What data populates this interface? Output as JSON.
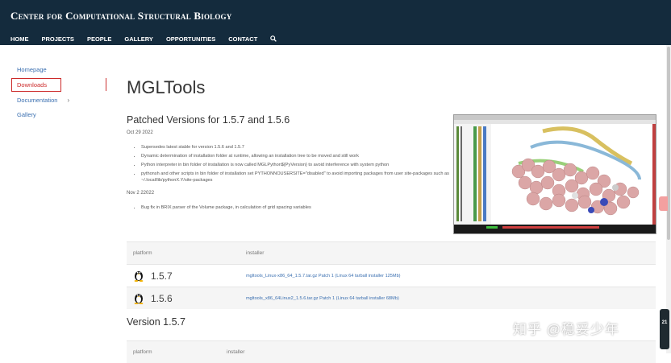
{
  "header": {
    "site_title": "Center for Computational Structural Biology",
    "nav": [
      "HOME",
      "PROJECTS",
      "PEOPLE",
      "GALLERY",
      "OPPORTUNITIES",
      "CONTACT"
    ]
  },
  "sidebar": {
    "items": [
      {
        "label": "Homepage"
      },
      {
        "label": "Downloads"
      },
      {
        "label": "Documentation"
      },
      {
        "label": "Gallery"
      }
    ]
  },
  "main": {
    "page_title": "MGLTools",
    "patched": {
      "title": "Patched Versions for 1.5.7 and 1.5.6",
      "date1": "Oct 29 2022",
      "notes1": [
        "Supersedes latest stable for version 1.5.6 and 1.5.7",
        "Dynamic determination of installation folder at runtime, allowing an installation tree to be moved and still work",
        "Python interpreter in bin folder of installation is now called MGLPython${PyVersion} to avoid interference with system python",
        "pythonsh and other scripts in bin folder of installation set PYTHONNOUSERSITE=\"disabled\" to avoid importing packages from user site-packages such as ~/.local/lib/pythonX.Y/site-packages"
      ],
      "date2": "Nov 2 22022",
      "notes2": [
        "Bug fix in BRIX parser of the Volume package, in calculation of grid spacing variables"
      ]
    },
    "table1": {
      "headers": [
        "platform",
        "installer"
      ],
      "rows": [
        {
          "version": "1.5.7",
          "link": "mgltools_Linux-x86_64_1.5.7.tar.gz Patch 1 (Linux 64 tarball installer 125Mb)"
        },
        {
          "version": "1.5.6",
          "link": "mgltools_x86_64Linux2_1.5.6.tar.gz Patch 1 (Linux 64 tarball installer 68Mb)"
        }
      ]
    },
    "version_title": "Version 1.5.7",
    "table2": {
      "headers": [
        "platform",
        "installer"
      ]
    }
  },
  "watermark": "知乎 @稳妥少年",
  "widget_number": "21",
  "colors": {
    "header_bg": "#142b3d",
    "link": "#3a6fb0",
    "active_border": "#cc2a2a"
  }
}
